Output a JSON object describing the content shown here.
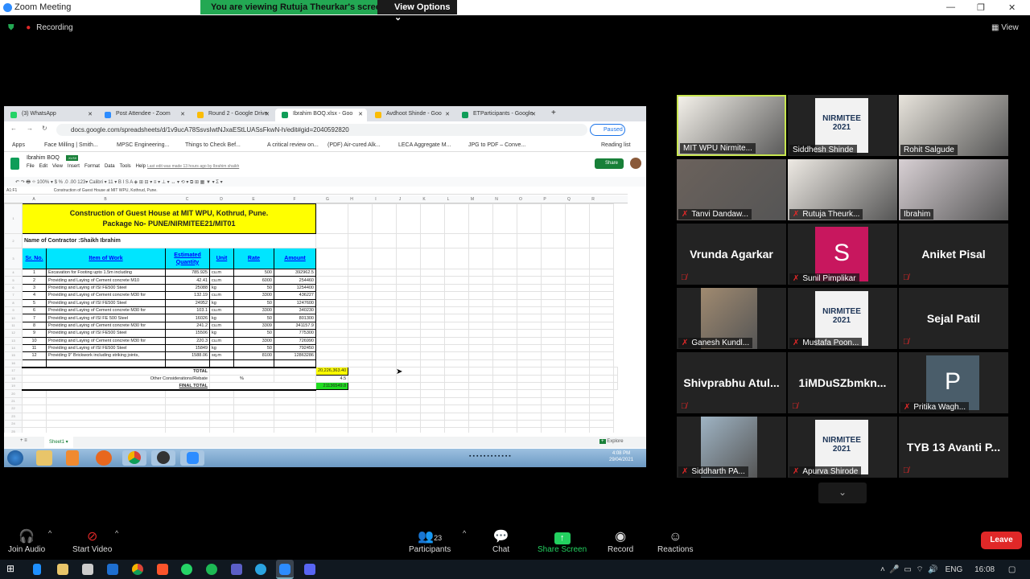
{
  "window": {
    "title": "Zoom Meeting",
    "banner": "You are viewing Rutuja Theurkar's screen",
    "view_options": "View Options ⌄",
    "recording": "Recording",
    "view": "View"
  },
  "browser": {
    "tabs": [
      {
        "label": "(3) WhatsApp",
        "color": "#25d366"
      },
      {
        "label": "Post Attendee - Zoom",
        "color": "#2d8cff"
      },
      {
        "label": "Round 2 - Google Drive",
        "color": "#fbbc04"
      },
      {
        "label": "Ibrahim BOQ.xlsx - Goo",
        "color": "#0f9d58"
      },
      {
        "label": "Avdhoot Shinde - Goo",
        "color": "#fbbc04"
      },
      {
        "label": "ETParticipants - Google",
        "color": "#0f9d58"
      }
    ],
    "url": "docs.google.com/spreadsheets/d/1v9ucA78SsvsIwtNJxaEStLUASsFkwN-h/edit#gid=2040592820",
    "profile_status": "Paused",
    "bookmarks": [
      "Apps",
      "Face Milling | Smith...",
      "MPSC Engineering...",
      "Things to Check Bef...",
      "A critical review on...",
      "(PDF) Air-cured Alk...",
      "LECA Aggregate M...",
      "JPG to PDF – Conve..."
    ],
    "reading_list": "Reading list"
  },
  "sheet": {
    "doc_title": "Ibrahim BOQ",
    "badge": ".XLSX",
    "menu": [
      "File",
      "Edit",
      "View",
      "Insert",
      "Format",
      "Data",
      "Tools",
      "Help"
    ],
    "last_edit": "Last edit was made 13 hours ago by Ibrahim shaikh",
    "share": "Share",
    "toolbar": "↶ ↷ 🖶 ⌖  100% ▾  $  %  .0  .00  123▾  Calibri ▾  11 ▾  B  I  S  A  ◈  ⊞  ⊟ ▾  ≡ ▾  ⊥ ▾  ↔ ▾  ⟲ ▾  ⧉  ⊞  ▦  ▼ ▾  Σ ▾",
    "cell_ref": "A1:F1",
    "formula": "Construction of Guest House at MIT WPU, Kothrud, Pune.",
    "columns": [
      "A",
      "B",
      "C",
      "D",
      "E",
      "F",
      "G",
      "H",
      "I",
      "J",
      "K",
      "L",
      "M",
      "N",
      "O",
      "P",
      "Q",
      "R"
    ],
    "title_line1": "Construction of Guest House at MIT WPU, Kothrud, Pune.",
    "title_line2": "Package No- PUNE/NIRMITEE21/MIT01",
    "contractor": "Name of Contractor :Shaikh Ibrahim",
    "headers": [
      "Sr. No.",
      "Item of Work",
      "Estimated Quantity",
      "Unit",
      "Rate",
      "Amount"
    ],
    "rows": [
      [
        "1",
        "Excavation for Footing upto 1.5m including",
        "785.925",
        "cu.m",
        "500",
        "392962.5"
      ],
      [
        "2",
        "Providing and Laying of Cement concrete M10",
        "42.41",
        "cu.m",
        "6000",
        "254460"
      ],
      [
        "3",
        "Providing and Laying of ISI FE500 Steel",
        "25088",
        "kg",
        "50",
        "1254400"
      ],
      [
        "4",
        "Providing and Laying of Cement concrete M30 for",
        "132.19",
        "cu.m",
        "3300",
        "436227"
      ],
      [
        "5",
        "Providing and Laying of ISI FE500 Steel",
        "24952",
        "kg",
        "50",
        "1247600"
      ],
      [
        "6",
        "Providing and Laying of Cement concrete M30 for",
        "103.1",
        "cu.m",
        "3300",
        "340230"
      ],
      [
        "7",
        "Providing and Laying of ISI FE 500 Steel",
        "16026",
        "kg",
        "50",
        "801300"
      ],
      [
        "8",
        "Providing and Laying of Cement concrete M30 for",
        "241.2",
        "cu.m",
        "3309",
        "341157.9"
      ],
      [
        "9",
        "Providing and Laying of ISI FE500 Steel",
        "15506",
        "kg",
        "50",
        "775300"
      ],
      [
        "10",
        "Providing and Laying of Cement concrete M30 for",
        "220.3",
        "cu.m",
        "3300",
        "726990"
      ],
      [
        "11",
        "Providing and Laying of ISI FE500 Steel",
        "15849",
        "kg",
        "50",
        "792450"
      ],
      [
        "12",
        "Providing 9\" Brickwork including striking joints,",
        "1588.06",
        "sq.m",
        "8100",
        "12863286"
      ]
    ],
    "total_label": "TOTAL",
    "total_value": "20,226,363.40",
    "rebate_label": "Other Considerations/Rebate",
    "rebate_unit": "%",
    "rebate_value": "4.5",
    "final_label": "FINAL TOTAL",
    "final_value": "21136549.8",
    "sheet_tab": "Sheet1 ▾",
    "explore": "Explore",
    "clock_time": "4:08 PM",
    "clock_date": "29/04/2021"
  },
  "participants": [
    {
      "name": "MIT WPU Nirmite...",
      "type": "video",
      "bg": "#f4f1ea",
      "active": true
    },
    {
      "name": "Siddhesh Shinde",
      "type": "logo",
      "bg": "#f2f2f2"
    },
    {
      "name": "Rohit Salgude",
      "type": "video",
      "bg": "#e8e4dc"
    },
    {
      "name": "Tanvi Dandaw...",
      "type": "video",
      "bg": "#6b625c",
      "muted": true
    },
    {
      "name": "Rutuja Theurk...",
      "type": "video",
      "bg": "#eeeae4",
      "muted": true
    },
    {
      "name": "Ibrahim",
      "type": "video",
      "bg": "#d8d0d4"
    },
    {
      "name": "Vrunda Agarkar",
      "type": "text",
      "muted": true
    },
    {
      "name": "Sunil Pimplikar",
      "type": "avatar",
      "letter": "S",
      "bg": "#c8175e",
      "muted": true
    },
    {
      "name": "Aniket Pisal",
      "type": "text",
      "muted": true
    },
    {
      "name": "Ganesh Kundl...",
      "type": "video",
      "bg": "#a08a70",
      "muted": true
    },
    {
      "name": "Mustafa Poon...",
      "type": "logo",
      "bg": "#f2f2f2",
      "muted": true
    },
    {
      "name": "Sejal Patil",
      "type": "text",
      "muted": true
    },
    {
      "name": "Shivprabhu  Atul...",
      "type": "text",
      "muted": true
    },
    {
      "name": "1iMDuSZbmkn...",
      "type": "text",
      "muted": true
    },
    {
      "name": "Pritika Wagh...",
      "type": "avatar",
      "letter": "P",
      "bg": "#4a5d6a",
      "muted": true
    },
    {
      "name": "Siddharth PA...",
      "type": "video",
      "bg": "#9fb4c4",
      "muted": true
    },
    {
      "name": "Apurva Shirode",
      "type": "logo",
      "bg": "#f2f2f2",
      "muted": true
    },
    {
      "name": "TYB 13  Avanti P...",
      "type": "text",
      "muted": true
    }
  ],
  "logo_text": "NIRMITEE 2021",
  "controls": {
    "join_audio": "Join Audio",
    "start_video": "Start Video",
    "participants": "Participants",
    "participant_count": "23",
    "chat": "Chat",
    "share_screen": "Share Screen",
    "record": "Record",
    "reactions": "Reactions",
    "leave": "Leave"
  },
  "taskbar": {
    "language": "ENG",
    "time": "16:08"
  }
}
